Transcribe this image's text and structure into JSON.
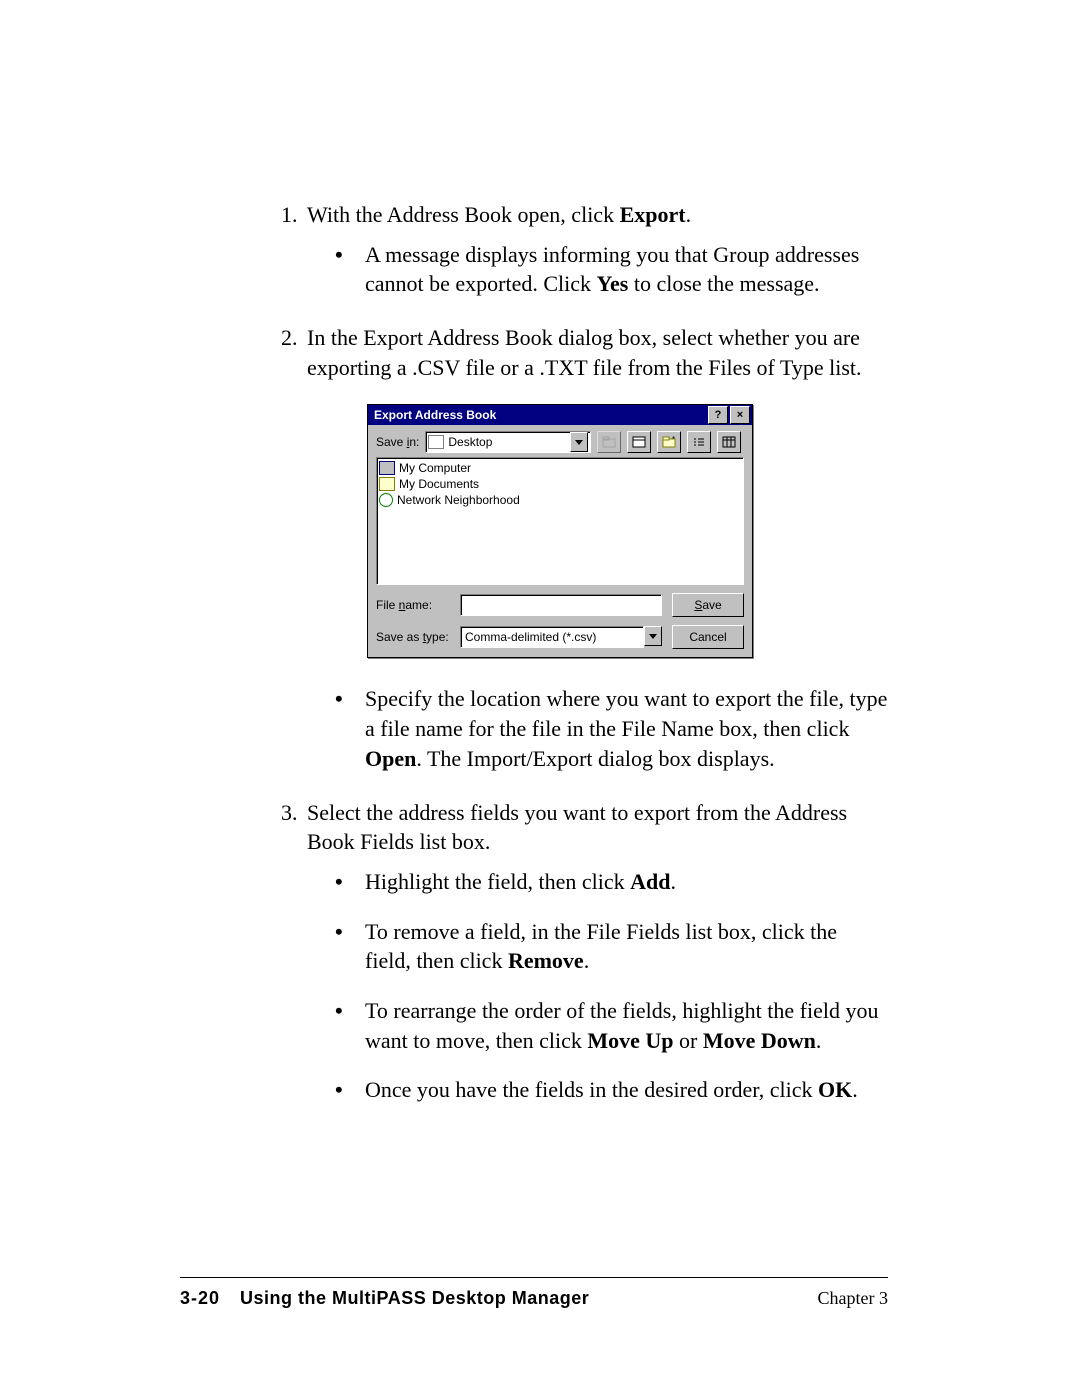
{
  "steps": {
    "s1": "With the Address Book open, click ",
    "s1_bold": "Export",
    "s1_end": ".",
    "s1_b1a": "A message displays informing you that Group addresses cannot be exported. Click ",
    "s1_b1_bold": "Yes",
    "s1_b1b": " to close the message.",
    "s2": "In the Export Address Book dialog box, select whether you are exporting a .CSV file or a .TXT file from the Files of Type list.",
    "s2_b1a": "Specify the location where you want to export the file, type a file name for the file in the File Name box, then click ",
    "s2_b1_bold": "Open",
    "s2_b1b": ". The Import/Export dialog box displays.",
    "s3": "Select the address fields you want to export from the Address Book Fields list box.",
    "s3_b1a": "Highlight the field, then click ",
    "s3_b1_bold": "Add",
    "s3_b1b": ".",
    "s3_b2a": "To remove a field, in the File Fields list box, click the field, then click ",
    "s3_b2_bold": "Remove",
    "s3_b2b": ".",
    "s3_b3a": "To rearrange the order of the fields, highlight the field you want to move, then click ",
    "s3_b3_bold1": "Move Up",
    "s3_b3_mid": " or ",
    "s3_b3_bold2": "Move Down",
    "s3_b3b": ".",
    "s3_b4a": "Once you have the fields in the desired order, click ",
    "s3_b4_bold": "OK",
    "s3_b4b": "."
  },
  "dialog": {
    "title": "Export Address Book",
    "savein_label": "Save in:",
    "savein_value": "Desktop",
    "items": {
      "i0": "My Computer",
      "i1": "My Documents",
      "i2": "Network Neighborhood"
    },
    "filename_label": "File name:",
    "filename_value": "",
    "saveastype_label": "Save as type:",
    "saveastype_value": "Comma-delimited (*.csv)",
    "save_btn_pre": "S",
    "save_btn_rest": "ave",
    "cancel_btn": "Cancel"
  },
  "footer": {
    "page": "3-20",
    "title": "Using the MultiPASS Desktop Manager",
    "chapter": "Chapter 3"
  }
}
